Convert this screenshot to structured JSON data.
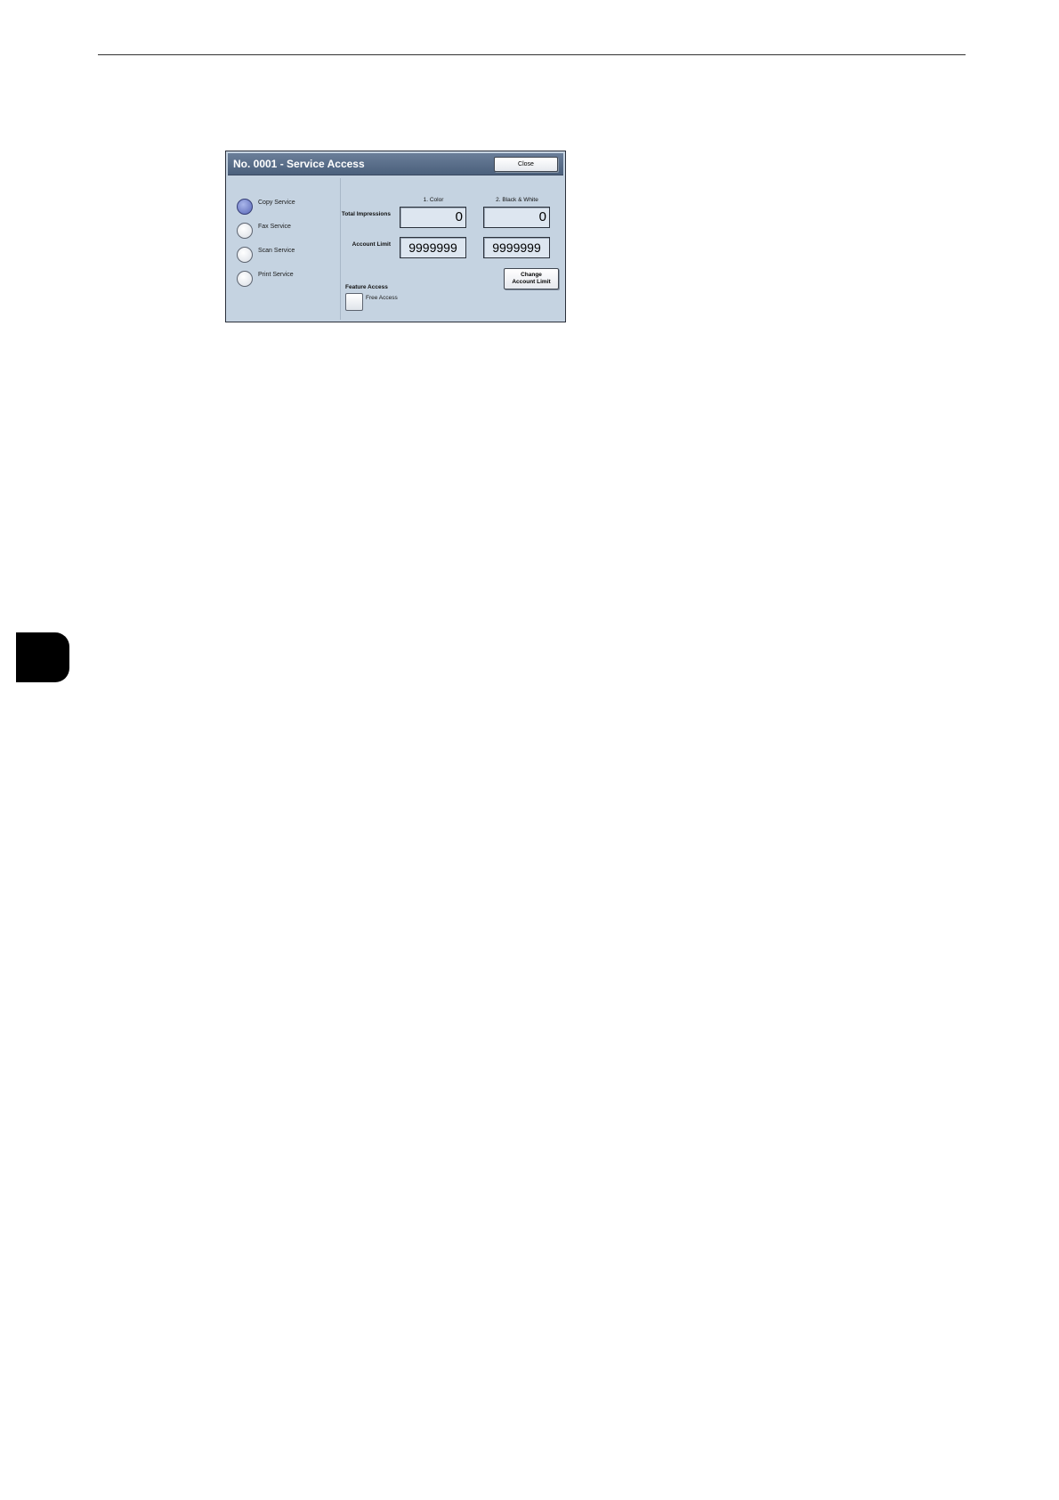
{
  "dialog": {
    "title": "No. 0001 - Service Access",
    "close_label": "Close"
  },
  "services": [
    {
      "label": "Copy Service",
      "selected": true
    },
    {
      "label": "Fax Service",
      "selected": false
    },
    {
      "label": "Scan Service",
      "selected": false
    },
    {
      "label": "Print Service",
      "selected": false
    }
  ],
  "columns": {
    "color": "1. Color",
    "black_white": "2. Black & White"
  },
  "rows": {
    "total_impressions": {
      "label": "Total Impressions",
      "color_value": "0",
      "bw_value": "0"
    },
    "account_limit": {
      "label": "Account Limit",
      "color_value": "9999999",
      "bw_value": "9999999"
    }
  },
  "change_button": {
    "line1": "Change",
    "line2": "Account Limit"
  },
  "feature_access": {
    "label": "Feature Access",
    "option_label": "Free Access",
    "checked": false
  }
}
